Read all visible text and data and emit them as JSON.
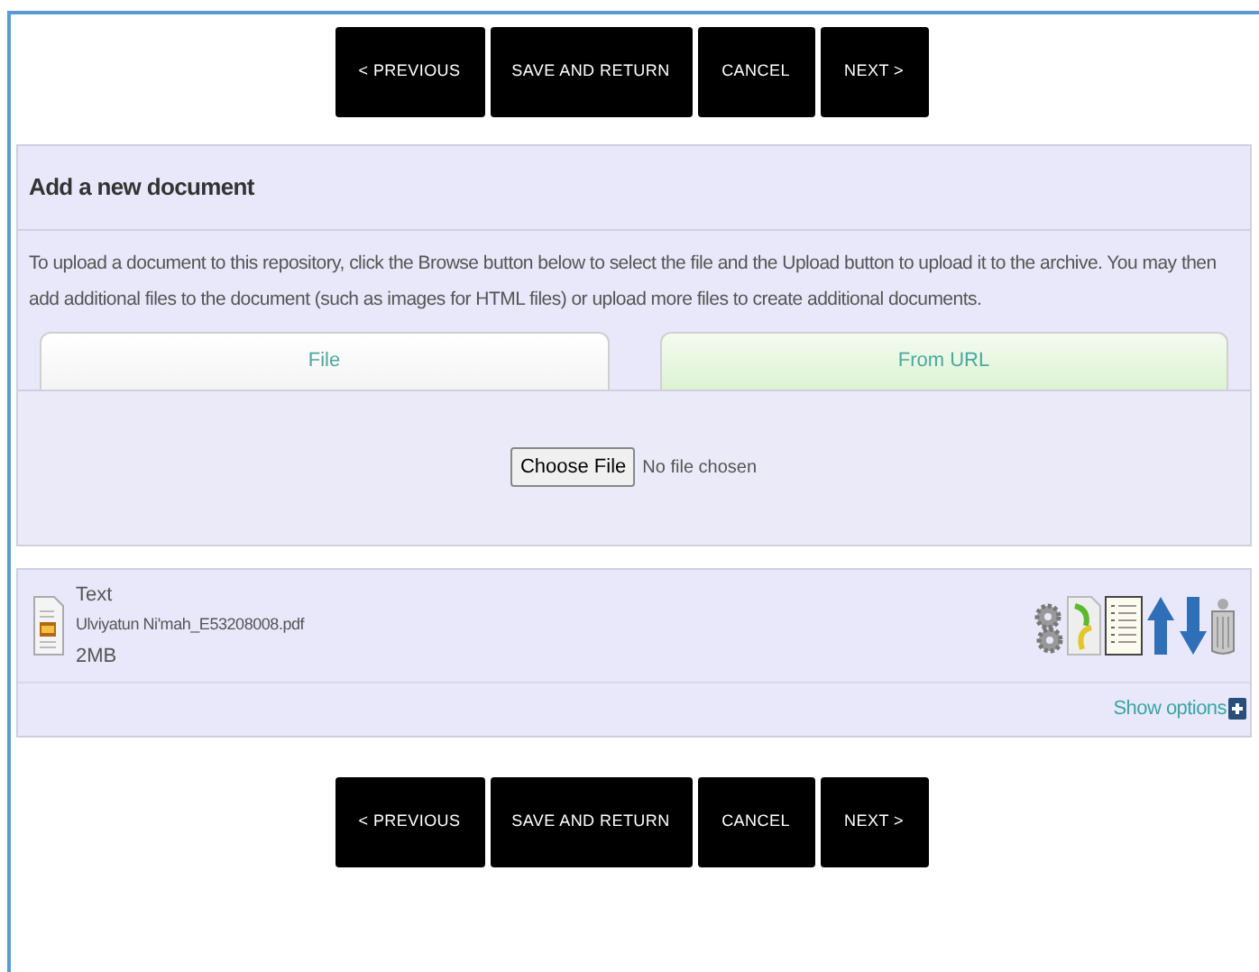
{
  "nav_top": [
    "< PREVIOUS",
    "SAVE AND RETURN",
    "CANCEL",
    "NEXT >"
  ],
  "section": {
    "title": "Add a new document",
    "description": "To upload a document to this repository, click the Browse button below to select the file and the Upload button to upload it to the archive. You may then add additional files to the document (such as images for HTML files) or upload more files to create additional documents."
  },
  "tabs": [
    {
      "label": "File",
      "selected": true
    },
    {
      "label": "From URL",
      "selected": false
    }
  ],
  "file_input": {
    "button": "Choose File",
    "status": "No file chosen"
  },
  "document": {
    "type": "Text",
    "filename": "Ulviyatun Ni'mah_E53208008.pdf",
    "size": "2MB",
    "show_options": "Show options"
  },
  "nav_bottom": [
    "< PREVIOUS",
    "SAVE AND RETURN",
    "CANCEL",
    "NEXT >"
  ]
}
